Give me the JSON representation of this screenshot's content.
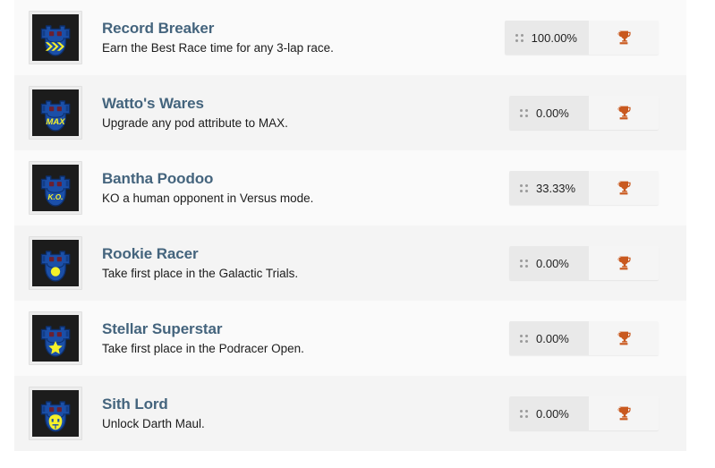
{
  "theme": {
    "row_bg_odd": "#fafafa",
    "row_bg_even": "#f4f4f4",
    "title_color": "#44647d",
    "desc_color": "#1c1c1c",
    "trophy_color": "#c9591f",
    "badge_pct_bg": "#e9e9e9",
    "badge_trophy_bg": "#f5f5f5",
    "icon_art_bg": "#1c1c1c",
    "icon_emblem_blue": "#1b4fa8",
    "icon_emblem_yellow": "#f5f02a",
    "icon_emblem_maroon": "#6d1f2f",
    "page_bg": "#ffffff"
  },
  "achievements": [
    {
      "title": "Record Breaker",
      "description": "Earn the Best Race time for any 3-lap race.",
      "percent": "100.00%",
      "emblem": "chevrons",
      "emblem_text": "",
      "icon_name": "achievement-badge-record-breaker",
      "trophy_icon": "trophy-icon",
      "grip_icon": "grip-dots-icon"
    },
    {
      "title": "Watto's Wares",
      "description": "Upgrade any pod attribute to MAX.",
      "percent": "0.00%",
      "emblem": "text",
      "emblem_text": "MAX",
      "icon_name": "achievement-badge-wattos-wares",
      "trophy_icon": "trophy-icon",
      "grip_icon": "grip-dots-icon"
    },
    {
      "title": "Bantha Poodoo",
      "description": "KO a human opponent in Versus mode.",
      "percent": "33.33%",
      "emblem": "text",
      "emblem_text": "K.O.",
      "icon_name": "achievement-badge-bantha-poodoo",
      "trophy_icon": "trophy-icon",
      "grip_icon": "grip-dots-icon"
    },
    {
      "title": "Rookie Racer",
      "description": "Take first place in the Galactic Trials.",
      "percent": "0.00%",
      "emblem": "dot",
      "emblem_text": "",
      "icon_name": "achievement-badge-rookie-racer",
      "trophy_icon": "trophy-icon",
      "grip_icon": "grip-dots-icon"
    },
    {
      "title": "Stellar Superstar",
      "description": "Take first place in the Podracer Open.",
      "percent": "0.00%",
      "emblem": "star",
      "emblem_text": "",
      "icon_name": "achievement-badge-stellar-superstar",
      "trophy_icon": "trophy-icon",
      "grip_icon": "grip-dots-icon"
    },
    {
      "title": "Sith Lord",
      "description": "Unlock Darth Maul.",
      "percent": "0.00%",
      "emblem": "face",
      "emblem_text": "",
      "icon_name": "achievement-badge-sith-lord",
      "trophy_icon": "trophy-icon",
      "grip_icon": "grip-dots-icon"
    }
  ]
}
